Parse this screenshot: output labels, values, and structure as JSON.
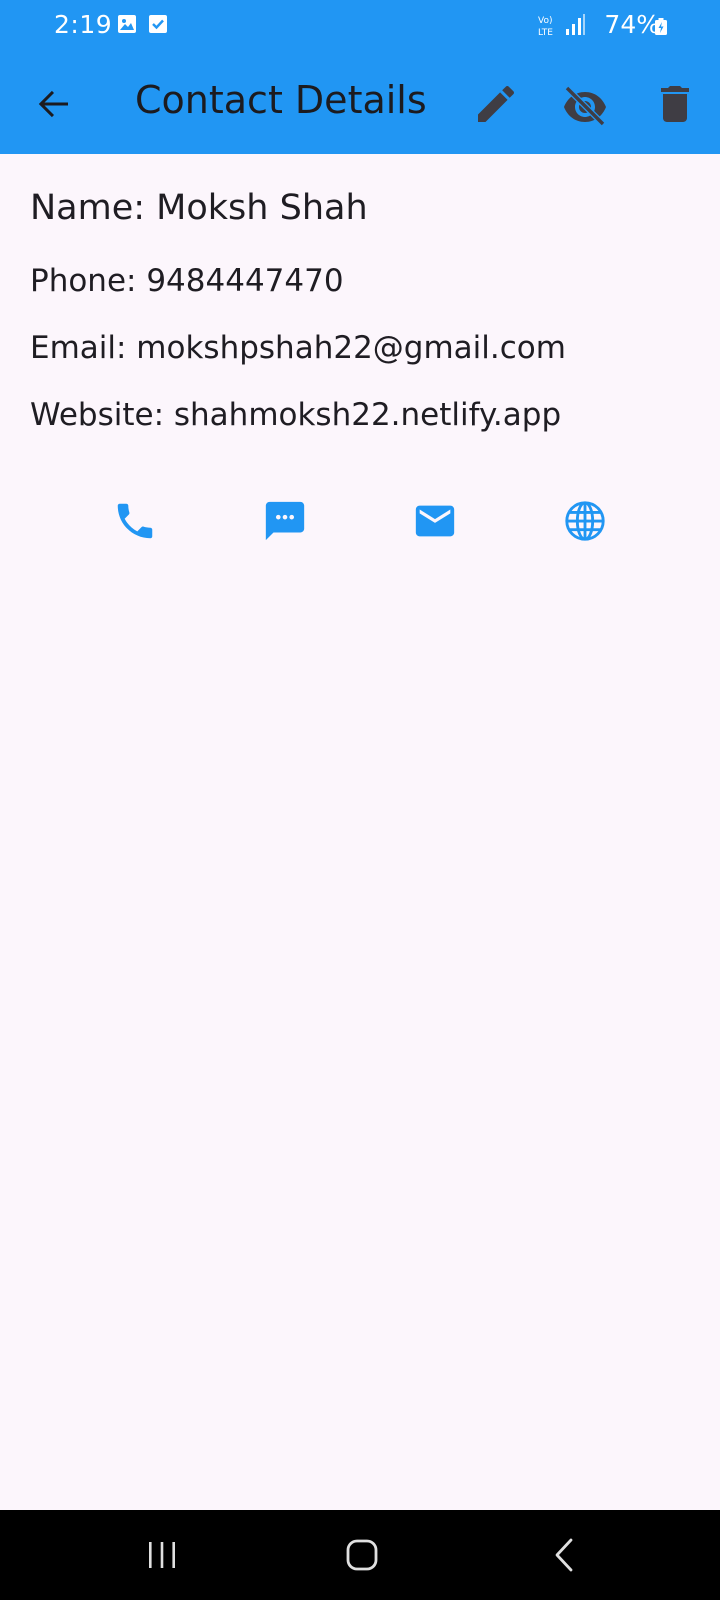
{
  "status_bar": {
    "time": "2:19",
    "battery": "74%",
    "network_label": "VoLTE",
    "icons": [
      "image-icon",
      "check-box-icon",
      "volte-icon",
      "signal-icon",
      "battery-charging-icon"
    ]
  },
  "app_bar": {
    "title": "Contact Details",
    "icons": [
      "back-arrow-icon",
      "edit-icon",
      "visibility-off-icon",
      "delete-icon"
    ]
  },
  "contact": {
    "name_line": "Name: Moksh Shah",
    "phone_line": "Phone: 9484447470",
    "email_line": "Email: mokshpshah22@gmail.com",
    "website_line": "Website: shahmoksh22.netlify.app"
  },
  "actions": {
    "icons": [
      "phone-icon",
      "message-icon",
      "email-icon",
      "globe-icon"
    ]
  },
  "nav_bar": {
    "icons": [
      "recents-icon",
      "home-icon",
      "back-icon"
    ]
  },
  "colors": {
    "primary": "#2196f3",
    "background": "#fcf6fc",
    "text": "#1f1d23",
    "app_bar_icon": "#3f3d44"
  }
}
